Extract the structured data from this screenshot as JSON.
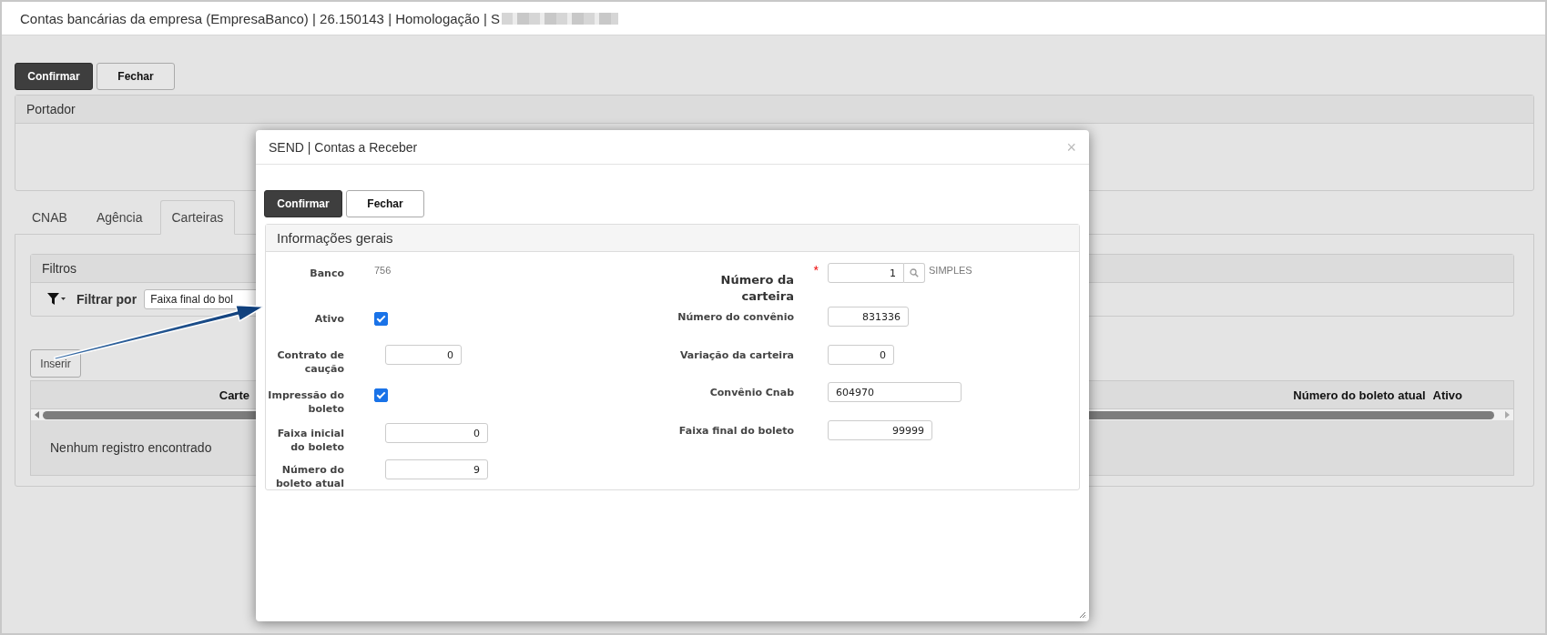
{
  "header": {
    "title": "Contas bancárias da empresa (EmpresaBanco) | 26.150143 | Homologação | S"
  },
  "toolbar": {
    "buttons": [
      {
        "label": "Confirmar",
        "kind": "primary"
      },
      {
        "label": "Fechar",
        "kind": "default"
      }
    ]
  },
  "portador": {
    "title": "Portador"
  },
  "tabs": [
    {
      "label": "CNAB",
      "selected": false
    },
    {
      "label": "Agência",
      "selected": false
    },
    {
      "label": "Carteiras",
      "selected": true
    }
  ],
  "filters": {
    "title": "Filtros",
    "label": "Filtrar por",
    "select_value": "Faixa final do bol"
  },
  "insert_button": {
    "label": "Inserir"
  },
  "table": {
    "columns": [
      {
        "label": "Carte"
      },
      {
        "label": "Número do boleto atual"
      },
      {
        "label": "Ativo"
      }
    ],
    "empty_message": "Nenhum registro encontrado"
  },
  "modal": {
    "title": "SEND | Contas a Receber",
    "close": "×",
    "buttons": [
      {
        "label": "Confirmar",
        "kind": "primary"
      },
      {
        "label": "Fechar",
        "kind": "default"
      }
    ],
    "section": {
      "title": "Informações gerais",
      "left": [
        {
          "label": "Banco",
          "kind": "static",
          "value": "756"
        },
        {
          "label": "Ativo",
          "kind": "checkbox",
          "checked": true
        },
        {
          "label": "Contrato de caução",
          "kind": "number",
          "value": "0"
        },
        {
          "label": "Impressão do boleto",
          "kind": "checkbox",
          "checked": true
        },
        {
          "label": "Faixa inicial do boleto",
          "kind": "number",
          "value": "0"
        },
        {
          "label": "Número do boleto atual",
          "kind": "number",
          "value": "9"
        }
      ],
      "right": [
        {
          "label": "Número da carteira",
          "kind": "lookup",
          "value": "1",
          "required": true,
          "required_mark": "*",
          "description": "SIMPLES"
        },
        {
          "label": "Número do convênio",
          "kind": "number",
          "value": "831336"
        },
        {
          "label": "Variação da carteira",
          "kind": "number",
          "value": "0"
        },
        {
          "label": "Convênio Cnab",
          "kind": "text",
          "value": "604970"
        },
        {
          "label": "Faixa final do boleto",
          "kind": "number",
          "value": "99999"
        }
      ]
    }
  }
}
